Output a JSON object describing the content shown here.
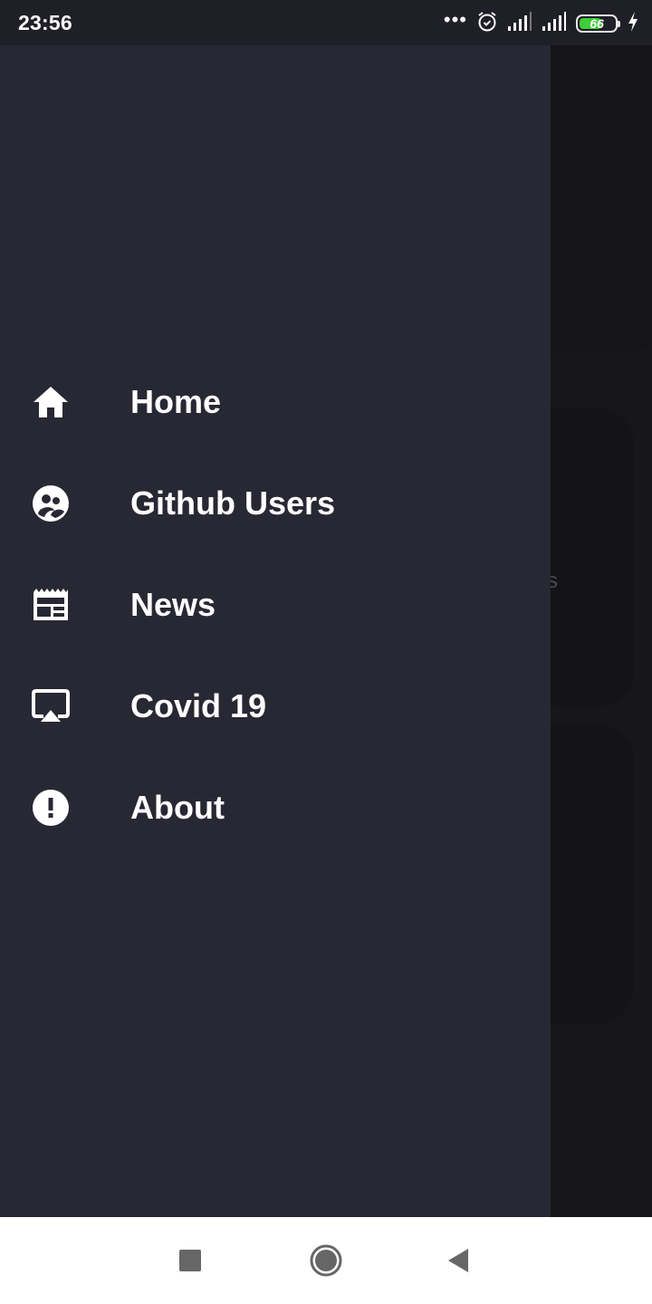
{
  "status_bar": {
    "time": "23:56",
    "more_indicator": "•••",
    "icons": [
      "alarm-icon",
      "signal-icon",
      "signal-icon",
      "battery-icon",
      "charging-icon"
    ],
    "battery_level": "66",
    "battery_fraction": 0.66,
    "battery_color": "#3fcd38"
  },
  "drawer": {
    "background_color": "#282834",
    "menu": [
      {
        "label": "Home",
        "icon": "home-icon"
      },
      {
        "label": "Github Users",
        "icon": "users-icon"
      },
      {
        "label": "News",
        "icon": "news-icon"
      },
      {
        "label": "Covid 19",
        "icon": "airplay-icon"
      },
      {
        "label": "About",
        "icon": "alert-icon"
      }
    ]
  },
  "background_app": {
    "peek_text": "s"
  },
  "nav_bar": {
    "buttons": [
      "recents-button",
      "home-button",
      "back-button"
    ]
  }
}
